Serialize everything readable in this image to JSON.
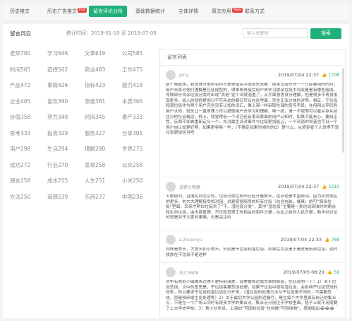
{
  "tabs": [
    {
      "label": "历史推文",
      "hot": ""
    },
    {
      "label": "历史广告推文",
      "hot": "Hot"
    },
    {
      "label": "留言评论分析",
      "hot": ""
    },
    {
      "label": "基础数据统计",
      "hot": ""
    },
    {
      "label": "主体详情",
      "hot": ""
    },
    {
      "label": "原文应用",
      "hot": "New"
    },
    {
      "label": "联系方式",
      "hot": ""
    }
  ],
  "panel": {
    "title": "留言词云",
    "stat": "统计时间：2019-01-10 至 2019-07-08"
  },
  "search": {
    "placeholder": "输入关键词",
    "button": "搜索"
  },
  "cloud": [
    "老师700",
    "学习646",
    "文章619",
    "公司585",
    "时间565",
    "选择502",
    "商业483",
    "工作475",
    "产品472",
    "事情426",
    "指标423",
    "能力418",
    "企业405",
    "喜欢390",
    "思维381",
    "本质366",
    "价值358",
    "努力348",
    "时间345",
    "春产333",
    "思考333",
    "投资329",
    "服务327",
    "分享301",
    "用户298",
    "生活294",
    "理解280",
    "世界275",
    "成功272",
    "行业270",
    "发现258",
    "公众258",
    "朋友258",
    "成本255",
    "人生251",
    "小米250",
    "方法250",
    "道理239",
    "东西237",
    "中国236"
  ],
  "list": {
    "title": "留言列表",
    "comments": [
      {
        "user": "Jerry",
        "date": "2019/07/04 22:37",
        "likes": "1708",
        "text": "给个角度想，我觉得分类的名称不单单增从字面意思来看：原余垃圾作为一个已经被用时的时，用户未身对他们理解是已经成型的，很难再去接受用户去学习那余垃圾中到底是是有哪些组成，导致部分将余垃圾分类时出现“其他”这个词就混重了，从字面意思就分理解，但是很多不再身发现更多，给人的就称是例分不可用途的都归可以在这里面，完全无法分体的对等。相反，干垃圾和湿垃圾作为两个用户完全没有认知的词汇，像上海一样采取在调的宣传手段，在用网以平同各用户认知，就反让一直原理上可以提使用户去学习和理解。唯一投，请一不按照可以者从存从前往分的社会概念，样上，我觉得会一个词已经有很深厚面的用户认知时，如果不能夫心，要纷正性，反倒不如去重新定义一个，先对最生词对事件与垃圾更加能让，一个词语的说者也可以一个用户自认知更好明，如果更容易一些，（不确定如果时候的的Q）是什么，从感受者个人觉得干湿垃圾更加恰当吧"
      },
      {
        "user": "迎建士畅懒",
        "date": "2019/07/04 22:37",
        "likes": "1210",
        "text": "不敢前同，当搜实到北京知，垃圾分类在杭州已经开展数年，这点也是中国很动。因为农村地区的更多，老大大理解接受相对困，总是感觉厨房的所有垃圾（包含包装，餐具）的可“厨余垃圾”里面，后来才明白垃圾到了“干、湿垃圾分类”，其中“湿垃圾”主要是一类垃圾回收时的剩余和生命垃圾，由市容管理，不仅和其里工作相关的卖件方便，在此之前的人民日报，新华社讨论的就是对于大家的事情，也是关注的"
      },
      {
        "user": "a.zhuxinyu",
        "date": "2019/07/04 22:33",
        "likes": "768",
        "text": "同样是骨头，大骨头和小骨头，分别是干垃圾和湿垃圾，如果在北京是不是就是厨余垃圾，就时候放在干垃圾不是这样"
      },
      {
        "user": "白乙3808",
        "date": "2019/07/05 08:29",
        "likes": "59",
        "text": "文中有两处小细微表达得不是特别清楚，会常被表达成文章的疑惑，在此说明一下：1）关于垃圾焚烧，文中的意思是，干垃圾需要焚烧处理，如果干垃圾中混有湿垃圾，会影响干垃圾焚烧的效率，所以要求干垃圾和湿垃圾区分开来。（湿垃圾的处理方法与干垃圾是不同的，不需要焚烧，而是粉碎或生化处理等）2）关于最后大学公园附近餐厅，是在每个大学里面有自己的集合点，不是在一个广场上同时有很多大学的集合点，集合点分别位于学校里面。搭子上就不用需要了上大学去学校。3）青小伙伴说，上海的“可回收垃圾”也叫做“可回收物”，感谢指出😂😂😂"
      }
    ]
  },
  "icons": {
    "thumb": "thumbs-up-icon"
  }
}
